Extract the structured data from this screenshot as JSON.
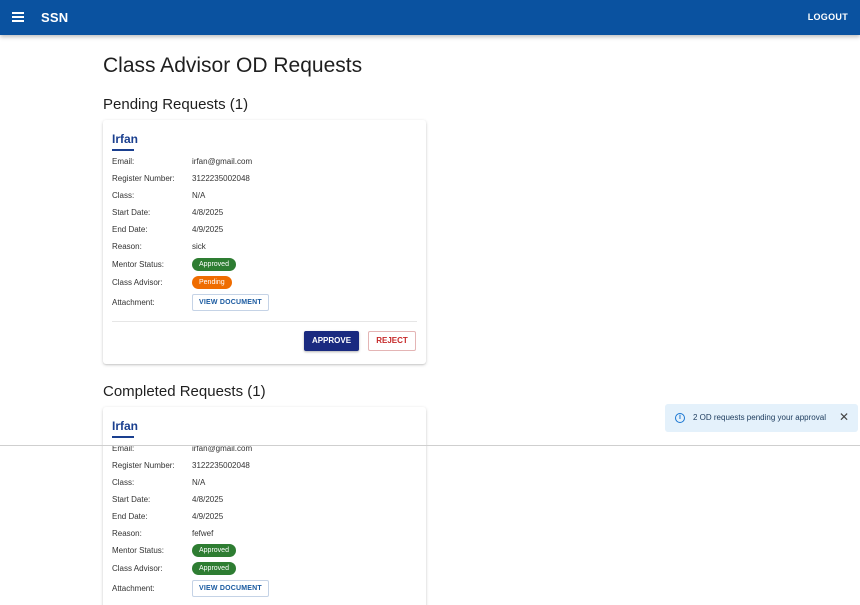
{
  "appbar": {
    "brand": "SSN",
    "logout_label": "LOGOUT"
  },
  "page_title": "Class Advisor OD Requests",
  "pending": {
    "heading": "Pending Requests (1)",
    "requests": [
      {
        "name": "Irfan",
        "email_label": "Email:",
        "email": "irfan@gmail.com",
        "register_label": "Register Number:",
        "register": "3122235002048",
        "class_label": "Class:",
        "class": "N/A",
        "start_label": "Start Date:",
        "start": "4/8/2025",
        "end_label": "End Date:",
        "end": "4/9/2025",
        "reason_label": "Reason:",
        "reason": "sick",
        "mentor_label": "Mentor Status:",
        "mentor_status": "Approved",
        "advisor_label": "Class Advisor:",
        "advisor_status": "Pending",
        "attachment_label": "Attachment:",
        "view_document": "VIEW DOCUMENT",
        "approve_label": "APPROVE",
        "reject_label": "REJECT"
      }
    ]
  },
  "completed": {
    "heading": "Completed Requests (1)",
    "requests": [
      {
        "name": "Irfan",
        "email_label": "Email:",
        "email": "irfan@gmail.com",
        "register_label": "Register Number:",
        "register": "3122235002048",
        "class_label": "Class:",
        "class": "N/A",
        "start_label": "Start Date:",
        "start": "4/8/2025",
        "end_label": "End Date:",
        "end": "4/9/2025",
        "reason_label": "Reason:",
        "reason": "fefwef",
        "mentor_label": "Mentor Status:",
        "mentor_status": "Approved",
        "advisor_label": "Class Advisor:",
        "advisor_status": "Approved",
        "attachment_label": "Attachment:",
        "view_document": "VIEW DOCUMENT"
      }
    ]
  },
  "snackbar": {
    "message": "2 OD requests pending your approval",
    "info_icon": "i",
    "close_icon": "✕"
  },
  "colors": {
    "appbar": "#0a52a0",
    "approved": "#2e7d32",
    "pending": "#ef6c00",
    "approve_button": "#1a2a80",
    "reject_text": "#c62828"
  }
}
